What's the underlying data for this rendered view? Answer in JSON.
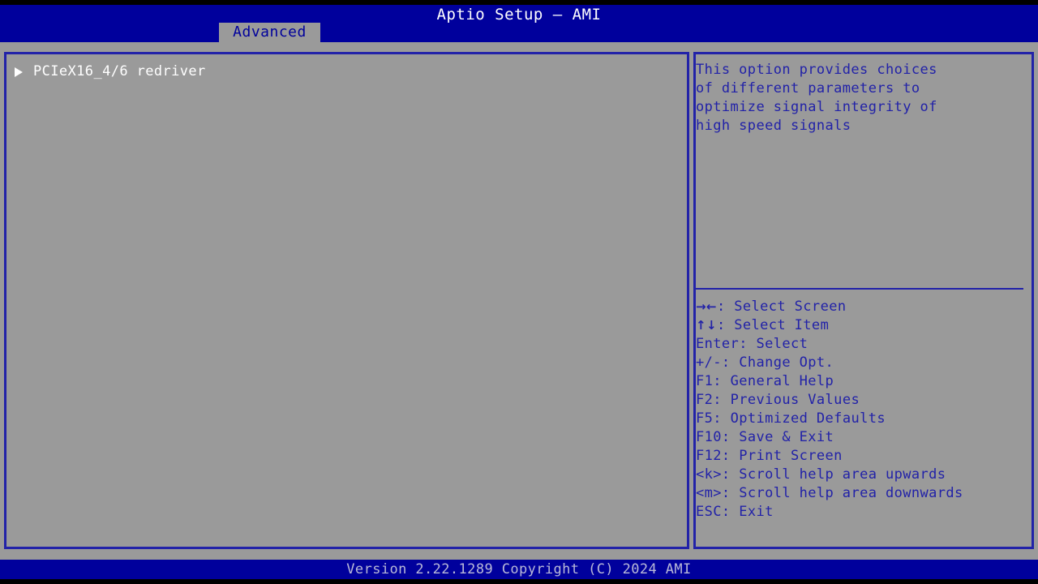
{
  "header": {
    "title": "Aptio Setup – AMI",
    "bar_color": "#00009c",
    "title_color": "#ffffff"
  },
  "tabs": [
    {
      "label": "Advanced",
      "active": true
    }
  ],
  "main_panel": {
    "items": [
      {
        "label": "PCIeX16_4/6 redriver",
        "icon": "submenu-triangle-icon",
        "selected": true
      }
    ]
  },
  "help_panel": {
    "description_lines": [
      "This option provides choices",
      "of different parameters to",
      "optimize signal integrity of",
      "high speed signals"
    ],
    "key_legend": [
      {
        "glyph": "→←",
        "keys": "",
        "separator": ": ",
        "action": "Select Screen"
      },
      {
        "glyph": "↑↓",
        "keys": "",
        "separator": ": ",
        "action": "Select Item"
      },
      {
        "glyph": "",
        "keys": "Enter",
        "separator": ": ",
        "action": "Select"
      },
      {
        "glyph": "",
        "keys": "+/-",
        "separator": ": ",
        "action": "Change Opt."
      },
      {
        "glyph": "",
        "keys": "F1",
        "separator": ": ",
        "action": "General Help"
      },
      {
        "glyph": "",
        "keys": "F2",
        "separator": ": ",
        "action": "Previous Values"
      },
      {
        "glyph": "",
        "keys": "F5",
        "separator": ": ",
        "action": "Optimized Defaults"
      },
      {
        "glyph": "",
        "keys": "F10",
        "separator": ": ",
        "action": "Save & Exit"
      },
      {
        "glyph": "",
        "keys": "F12",
        "separator": ": ",
        "action": "Print Screen"
      },
      {
        "glyph": "",
        "keys": "<k>",
        "separator": ": ",
        "action": "Scroll help area upwards"
      },
      {
        "glyph": "",
        "keys": "<m>",
        "separator": ": ",
        "action": "Scroll help area downwards"
      },
      {
        "glyph": "",
        "keys": "ESC",
        "separator": ": ",
        "action": "Exit"
      }
    ]
  },
  "footer": {
    "version_text": "Version 2.22.1289 Copyright (C) 2024 AMI"
  },
  "colors": {
    "background": "#9a9a9a",
    "accent_blue": "#00009c",
    "border_blue": "#2222a8",
    "text_white": "#ffffff",
    "footer_text": "#b9b9d8"
  }
}
